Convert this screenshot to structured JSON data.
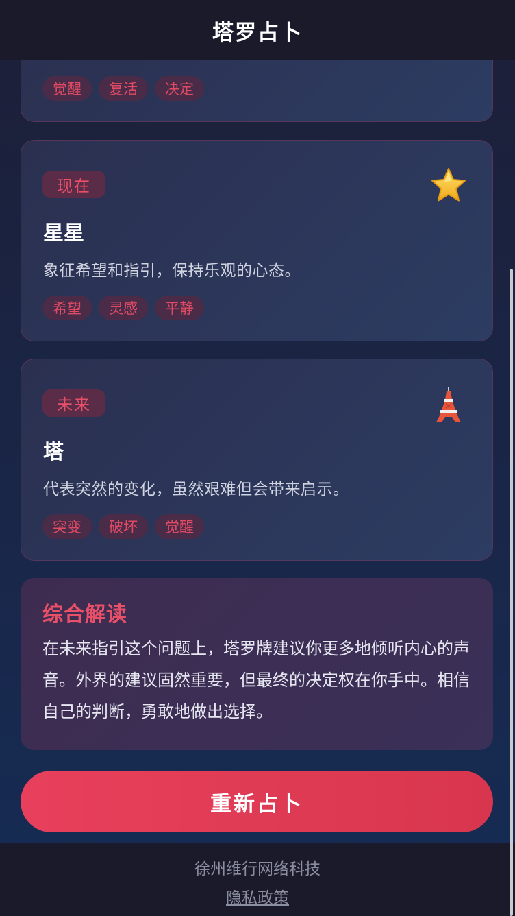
{
  "header": {
    "title": "塔罗占卜"
  },
  "cards": [
    {
      "keywords": [
        "觉醒",
        "复活",
        "决定"
      ]
    },
    {
      "position": "现在",
      "icon": "star-icon",
      "name": "星星",
      "description": "象征希望和指引，保持乐观的心态。",
      "keywords": [
        "希望",
        "灵感",
        "平静"
      ]
    },
    {
      "position": "未来",
      "icon": "tower-icon",
      "name": "塔",
      "description": "代表突然的变化，虽然艰难但会带来启示。",
      "keywords": [
        "突变",
        "破坏",
        "觉醒"
      ]
    }
  ],
  "summary": {
    "title": "综合解读",
    "text": "在未来指引这个问题上，塔罗牌建议你更多地倾听内心的声音。外界的建议固然重要，但最终的决定权在你手中。相信自己的判断，勇敢地做出选择。"
  },
  "actions": {
    "redo_label": "重新占卜"
  },
  "footer": {
    "company": "徐州维行网络科技",
    "privacy_label": "隐私政策"
  },
  "colors": {
    "accent": "#e8506a",
    "button": "#e03e58",
    "header_bg": "#1a1a2a"
  }
}
